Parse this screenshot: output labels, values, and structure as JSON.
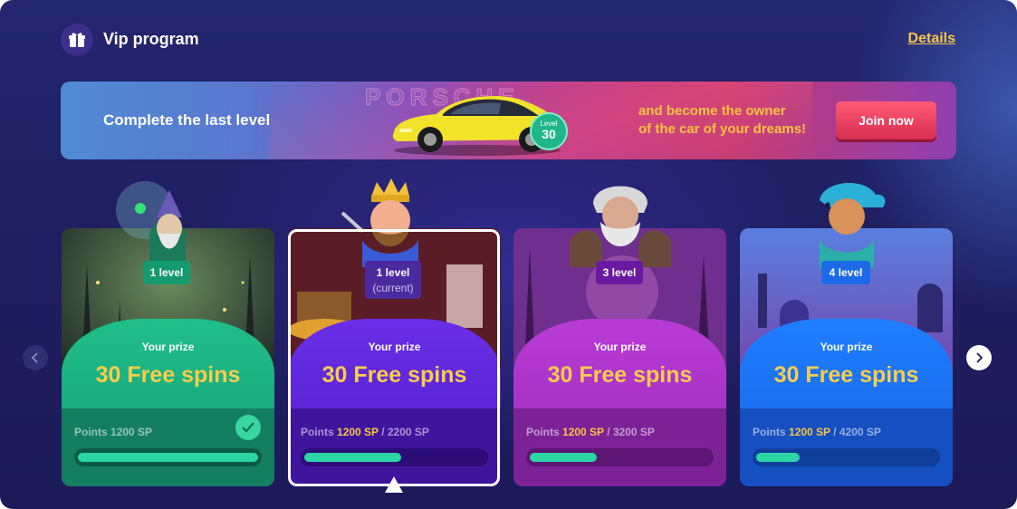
{
  "header": {
    "title": "Vip program",
    "details_label": "Details",
    "icon": "gift-icon"
  },
  "banner": {
    "left_text": "Complete the last level",
    "brand_word": "PORSCHE",
    "level_badge": {
      "label": "Level",
      "value": "30"
    },
    "cta_line1": "and become the owner",
    "cta_line2": "of the car of your dreams!",
    "join_label": "Join now"
  },
  "nav": {
    "prev_icon": "chevron-left-icon",
    "next_icon": "chevron-right-icon"
  },
  "cards": [
    {
      "level_label": "1 level",
      "level_sub": "",
      "prize_label": "Your prize",
      "prize_value": "30 Free spins",
      "points_prefix": "Points",
      "points_current": "1200 SP",
      "points_separator": "",
      "points_total": "",
      "progress": 1.0,
      "completed": true,
      "character": "wizard",
      "theme": "green"
    },
    {
      "level_label": "1 level",
      "level_sub": "(current)",
      "prize_label": "Your prize",
      "prize_value": "30 Free spins",
      "points_prefix": "Points",
      "points_current": "1200 SP",
      "points_separator": "/",
      "points_total": "2200 SP",
      "progress": 0.54,
      "completed": false,
      "current": true,
      "character": "king",
      "theme": "violet"
    },
    {
      "level_label": "3 level",
      "level_sub": "",
      "prize_label": "Your prize",
      "prize_value": "30 Free spins",
      "points_prefix": "Points",
      "points_current": "1200 SP",
      "points_separator": "/",
      "points_total": "3200 SP",
      "progress": 0.37,
      "completed": false,
      "character": "viking",
      "theme": "magenta"
    },
    {
      "level_label": "4  level",
      "level_sub": "",
      "prize_label": "Your prize",
      "prize_value": "30 Free spins",
      "points_prefix": "Points",
      "points_current": "1200 SP",
      "points_separator": "/",
      "points_total": "4200 SP",
      "progress": 0.24,
      "completed": false,
      "character": "genie",
      "theme": "blue"
    }
  ],
  "colors": {
    "accent_gold": "#f8cd4c",
    "progress_fill": "#2bd6a4",
    "join_button": "#e8405f"
  }
}
